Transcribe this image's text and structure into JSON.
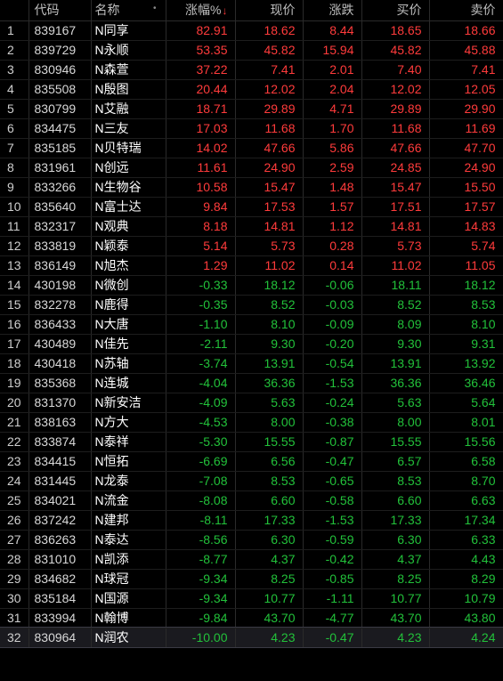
{
  "header": {
    "idx": "",
    "code": "代码",
    "name": "名称",
    "name_dot": "•",
    "pct": "涨幅%",
    "sort_arrow": "↓",
    "price": "现价",
    "change": "涨跌",
    "bid": "买价",
    "ask": "卖价"
  },
  "colors": {
    "up": "#ff3b3b",
    "down": "#22c13a",
    "background": "#000000"
  },
  "rows": [
    {
      "idx": "1",
      "code": "839167",
      "name": "N同享",
      "pct": "82.91",
      "price": "18.62",
      "change": "8.44",
      "bid": "18.65",
      "ask": "18.66",
      "dir": "up"
    },
    {
      "idx": "2",
      "code": "839729",
      "name": "N永顺",
      "pct": "53.35",
      "price": "45.82",
      "change": "15.94",
      "bid": "45.82",
      "ask": "45.88",
      "dir": "up"
    },
    {
      "idx": "3",
      "code": "830946",
      "name": "N森萱",
      "pct": "37.22",
      "price": "7.41",
      "change": "2.01",
      "bid": "7.40",
      "ask": "7.41",
      "dir": "up"
    },
    {
      "idx": "4",
      "code": "835508",
      "name": "N殷图",
      "pct": "20.44",
      "price": "12.02",
      "change": "2.04",
      "bid": "12.02",
      "ask": "12.05",
      "dir": "up"
    },
    {
      "idx": "5",
      "code": "830799",
      "name": "N艾融",
      "pct": "18.71",
      "price": "29.89",
      "change": "4.71",
      "bid": "29.89",
      "ask": "29.90",
      "dir": "up"
    },
    {
      "idx": "6",
      "code": "834475",
      "name": "N三友",
      "pct": "17.03",
      "price": "11.68",
      "change": "1.70",
      "bid": "11.68",
      "ask": "11.69",
      "dir": "up"
    },
    {
      "idx": "7",
      "code": "835185",
      "name": "N贝特瑞",
      "pct": "14.02",
      "price": "47.66",
      "change": "5.86",
      "bid": "47.66",
      "ask": "47.70",
      "dir": "up"
    },
    {
      "idx": "8",
      "code": "831961",
      "name": "N创远",
      "pct": "11.61",
      "price": "24.90",
      "change": "2.59",
      "bid": "24.85",
      "ask": "24.90",
      "dir": "up"
    },
    {
      "idx": "9",
      "code": "833266",
      "name": "N生物谷",
      "pct": "10.58",
      "price": "15.47",
      "change": "1.48",
      "bid": "15.47",
      "ask": "15.50",
      "dir": "up"
    },
    {
      "idx": "10",
      "code": "835640",
      "name": "N富士达",
      "pct": "9.84",
      "price": "17.53",
      "change": "1.57",
      "bid": "17.51",
      "ask": "17.57",
      "dir": "up"
    },
    {
      "idx": "11",
      "code": "832317",
      "name": "N观典",
      "pct": "8.18",
      "price": "14.81",
      "change": "1.12",
      "bid": "14.81",
      "ask": "14.83",
      "dir": "up"
    },
    {
      "idx": "12",
      "code": "833819",
      "name": "N颖泰",
      "pct": "5.14",
      "price": "5.73",
      "change": "0.28",
      "bid": "5.73",
      "ask": "5.74",
      "dir": "up"
    },
    {
      "idx": "13",
      "code": "836149",
      "name": "N旭杰",
      "pct": "1.29",
      "price": "11.02",
      "change": "0.14",
      "bid": "11.02",
      "ask": "11.05",
      "dir": "up"
    },
    {
      "idx": "14",
      "code": "430198",
      "name": "N微创",
      "pct": "-0.33",
      "price": "18.12",
      "change": "-0.06",
      "bid": "18.11",
      "ask": "18.12",
      "dir": "down"
    },
    {
      "idx": "15",
      "code": "832278",
      "name": "N鹿得",
      "pct": "-0.35",
      "price": "8.52",
      "change": "-0.03",
      "bid": "8.52",
      "ask": "8.53",
      "dir": "down"
    },
    {
      "idx": "16",
      "code": "836433",
      "name": "N大唐",
      "pct": "-1.10",
      "price": "8.10",
      "change": "-0.09",
      "bid": "8.09",
      "ask": "8.10",
      "dir": "down"
    },
    {
      "idx": "17",
      "code": "430489",
      "name": "N佳先",
      "pct": "-2.11",
      "price": "9.30",
      "change": "-0.20",
      "bid": "9.30",
      "ask": "9.31",
      "dir": "down"
    },
    {
      "idx": "18",
      "code": "430418",
      "name": "N苏轴",
      "pct": "-3.74",
      "price": "13.91",
      "change": "-0.54",
      "bid": "13.91",
      "ask": "13.92",
      "dir": "down"
    },
    {
      "idx": "19",
      "code": "835368",
      "name": "N连城",
      "pct": "-4.04",
      "price": "36.36",
      "change": "-1.53",
      "bid": "36.36",
      "ask": "36.46",
      "dir": "down"
    },
    {
      "idx": "20",
      "code": "831370",
      "name": "N新安洁",
      "pct": "-4.09",
      "price": "5.63",
      "change": "-0.24",
      "bid": "5.63",
      "ask": "5.64",
      "dir": "down"
    },
    {
      "idx": "21",
      "code": "838163",
      "name": "N方大",
      "pct": "-4.53",
      "price": "8.00",
      "change": "-0.38",
      "bid": "8.00",
      "ask": "8.01",
      "dir": "down"
    },
    {
      "idx": "22",
      "code": "833874",
      "name": "N泰祥",
      "pct": "-5.30",
      "price": "15.55",
      "change": "-0.87",
      "bid": "15.55",
      "ask": "15.56",
      "dir": "down"
    },
    {
      "idx": "23",
      "code": "834415",
      "name": "N恒拓",
      "pct": "-6.69",
      "price": "6.56",
      "change": "-0.47",
      "bid": "6.57",
      "ask": "6.58",
      "dir": "down"
    },
    {
      "idx": "24",
      "code": "831445",
      "name": "N龙泰",
      "pct": "-7.08",
      "price": "8.53",
      "change": "-0.65",
      "bid": "8.53",
      "ask": "8.70",
      "dir": "down"
    },
    {
      "idx": "25",
      "code": "834021",
      "name": "N流金",
      "pct": "-8.08",
      "price": "6.60",
      "change": "-0.58",
      "bid": "6.60",
      "ask": "6.63",
      "dir": "down"
    },
    {
      "idx": "26",
      "code": "837242",
      "name": "N建邦",
      "pct": "-8.11",
      "price": "17.33",
      "change": "-1.53",
      "bid": "17.33",
      "ask": "17.34",
      "dir": "down"
    },
    {
      "idx": "27",
      "code": "836263",
      "name": "N泰达",
      "pct": "-8.56",
      "price": "6.30",
      "change": "-0.59",
      "bid": "6.30",
      "ask": "6.33",
      "dir": "down"
    },
    {
      "idx": "28",
      "code": "831010",
      "name": "N凯添",
      "pct": "-8.77",
      "price": "4.37",
      "change": "-0.42",
      "bid": "4.37",
      "ask": "4.43",
      "dir": "down"
    },
    {
      "idx": "29",
      "code": "834682",
      "name": "N球冠",
      "pct": "-9.34",
      "price": "8.25",
      "change": "-0.85",
      "bid": "8.25",
      "ask": "8.29",
      "dir": "down"
    },
    {
      "idx": "30",
      "code": "835184",
      "name": "N国源",
      "pct": "-9.34",
      "price": "10.77",
      "change": "-1.11",
      "bid": "10.77",
      "ask": "10.79",
      "dir": "down"
    },
    {
      "idx": "31",
      "code": "833994",
      "name": "N翰博",
      "pct": "-9.84",
      "price": "43.70",
      "change": "-4.77",
      "bid": "43.70",
      "ask": "43.80",
      "dir": "down"
    },
    {
      "idx": "32",
      "code": "830964",
      "name": "N润农",
      "pct": "-10.00",
      "price": "4.23",
      "change": "-0.47",
      "bid": "4.23",
      "ask": "4.24",
      "dir": "down",
      "selected": true
    }
  ]
}
